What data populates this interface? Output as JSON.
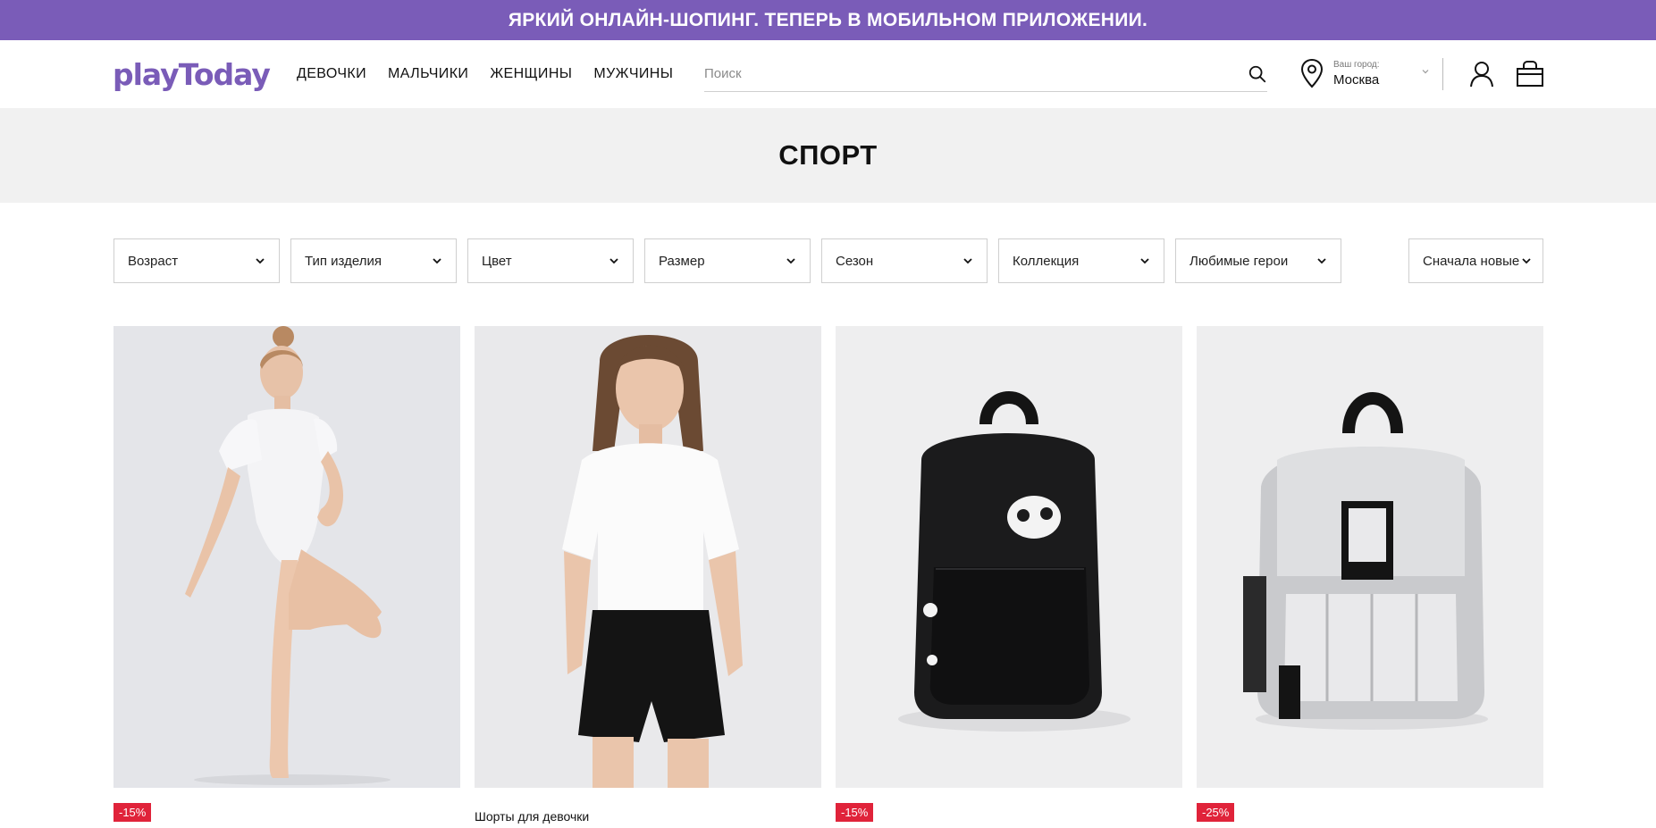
{
  "promo": {
    "text": "ЯРКИЙ ОНЛАЙН-ШОПИНГ. ТЕПЕРЬ В МОБИЛЬНОМ ПРИЛОЖЕНИИ."
  },
  "header": {
    "logo": "playToday",
    "nav": [
      "ДЕВОЧКИ",
      "МАЛЬЧИКИ",
      "ЖЕНЩИНЫ",
      "МУЖЧИНЫ"
    ],
    "search_placeholder": "Поиск",
    "city_hint": "Ваш город:",
    "city_name": "Москва"
  },
  "page": {
    "title": "СПОРТ"
  },
  "filters": [
    "Возраст",
    "Тип изделия",
    "Цвет",
    "Размер",
    "Сезон",
    "Коллекция",
    "Любимые герои"
  ],
  "sort": {
    "label": "Сначала новые"
  },
  "products": [
    {
      "badge": "-15%",
      "title": ""
    },
    {
      "badge": "",
      "title": "Шорты для девочки"
    },
    {
      "badge": "-15%",
      "title": ""
    },
    {
      "badge": "-25%",
      "title": ""
    }
  ],
  "colors": {
    "brand": "#7a5cb8",
    "sale_badge": "#e0233a",
    "hero_bg": "#f1f1f1"
  }
}
